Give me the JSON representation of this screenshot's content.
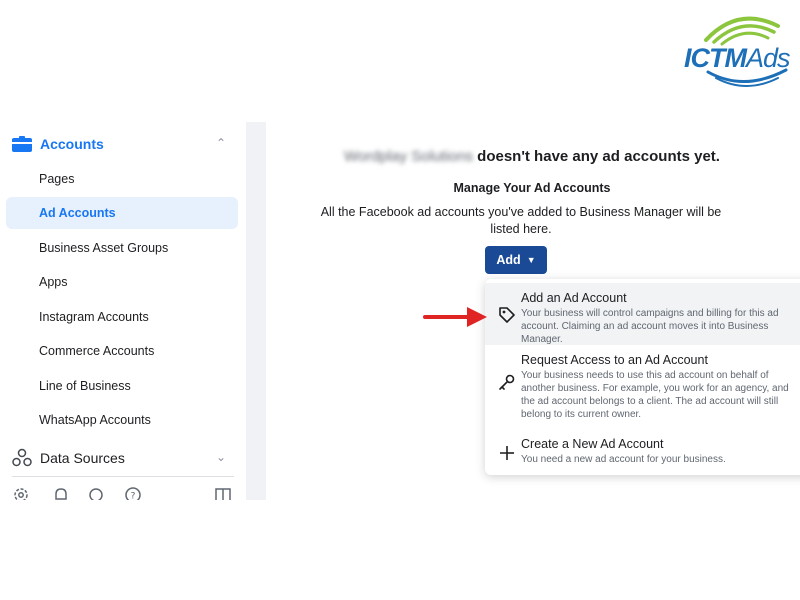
{
  "logo": {
    "brand_main": "ICTM",
    "brand_sub": "Ads"
  },
  "sidebar": {
    "accounts_label": "Accounts",
    "items": [
      {
        "label": "Pages",
        "active": false
      },
      {
        "label": "Ad Accounts",
        "active": true
      },
      {
        "label": "Business Asset Groups",
        "active": false
      },
      {
        "label": "Apps",
        "active": false
      },
      {
        "label": "Instagram Accounts",
        "active": false
      },
      {
        "label": "Commerce Accounts",
        "active": false
      },
      {
        "label": "Line of Business",
        "active": false
      },
      {
        "label": "WhatsApp Accounts",
        "active": false
      }
    ],
    "data_sources_label": "Data Sources",
    "bottom_icons": [
      "gear-icon",
      "bell-icon",
      "search-icon",
      "help-icon",
      "panel-icon"
    ]
  },
  "main": {
    "business_name_blurred": "Wordplay Solutions",
    "headline_rest": "doesn't have any ad accounts yet.",
    "sub_title": "Manage Your Ad Accounts",
    "description": "All the Facebook ad accounts you've added to Business Manager will be listed here.",
    "add_button": {
      "label": "Add"
    },
    "dropdown": [
      {
        "icon": "tag-icon",
        "title": "Add an Ad Account",
        "description": "Your business will control campaigns and billing for this ad account. Claiming an ad account moves it into Business Manager."
      },
      {
        "icon": "key-icon",
        "title": "Request Access to an Ad Account",
        "description": "Your business needs to use this ad account on behalf of another business. For example, you work for an agency, and the ad account belongs to a client. The ad account will still belong to its current owner."
      },
      {
        "icon": "plus-icon",
        "title": "Create a New Ad Account",
        "description": "You need a new ad account for your business."
      }
    ]
  },
  "colors": {
    "accent_blue": "#1877f2",
    "add_button_bg": "#1a4a96",
    "active_item_bg": "#e7f0fd",
    "arrow_red": "#e02424",
    "logo_blue": "#1d6fb8",
    "logo_green": "#8cc63f"
  }
}
